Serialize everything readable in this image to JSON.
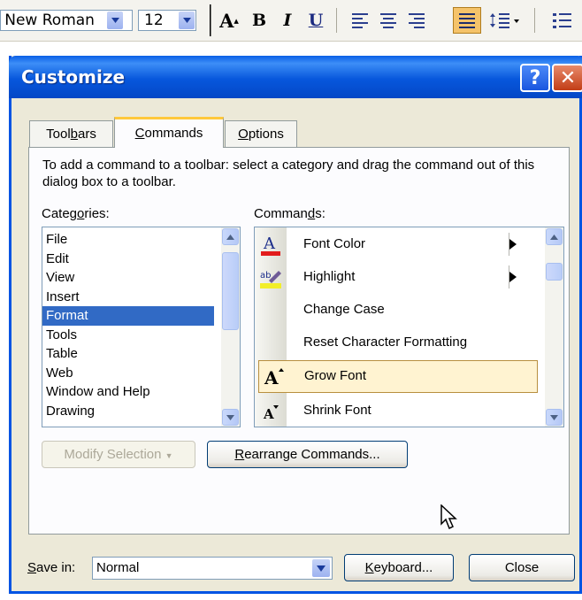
{
  "formatting_toolbar": {
    "font_name": "s New Roman",
    "font_size": "12",
    "bold_label": "B",
    "italic_label": "I",
    "underline_label": "U",
    "grow_font_label": "A"
  },
  "dialog": {
    "title": "Customize",
    "help_label": "?",
    "close_glyph": "✕",
    "tabs": [
      {
        "label": "Toolbars",
        "accesskey_prefix": "Tool",
        "accesskey": "b",
        "accesskey_suffix": "ars"
      },
      {
        "label": "Commands",
        "accesskey_prefix": "",
        "accesskey": "C",
        "accesskey_suffix": "ommands"
      },
      {
        "label": "Options",
        "accesskey_prefix": "",
        "accesskey": "O",
        "accesskey_suffix": "ptions"
      }
    ],
    "instructions": "To add a command to a toolbar: select a category and drag the command out of this dialog box to a toolbar.",
    "categories_label_pre": "Categ",
    "categories_label_key": "o",
    "categories_label_post": "ries:",
    "commands_label_pre": "Comman",
    "commands_label_key": "d",
    "commands_label_post": "s:",
    "categories": [
      "File",
      "Edit",
      "View",
      "Insert",
      "Format",
      "Tools",
      "Table",
      "Web",
      "Window and Help",
      "Drawing"
    ],
    "selected_category": "Format",
    "commands": [
      {
        "label": "Font Color",
        "icon": "font-color-icon",
        "has_submenu": true
      },
      {
        "label": "Highlight",
        "icon": "highlight-icon",
        "has_submenu": true
      },
      {
        "label": "Change Case",
        "icon": "",
        "has_submenu": false
      },
      {
        "label": "Reset Character Formatting",
        "icon": "",
        "has_submenu": false
      },
      {
        "label": "Grow Font",
        "icon": "grow-font-icon",
        "has_submenu": false
      },
      {
        "label": "Shrink Font",
        "icon": "shrink-font-icon",
        "has_submenu": false
      }
    ],
    "selected_command": "Grow Font",
    "modify_selection_label": "Modify Selection",
    "rearrange_label_key": "R",
    "rearrange_label_rest": "earrange Commands...",
    "save_in_label_key": "S",
    "save_in_label_rest": "ave in:",
    "save_in_value": "Normal",
    "keyboard_label_key": "K",
    "keyboard_label_rest": "eyboard...",
    "close_label": "Close"
  },
  "colors": {
    "title_blue": "#0054e3",
    "dialog_bg": "#ece9d8",
    "selection_blue": "#316ac5",
    "hover_orange": "#ffc83c"
  }
}
